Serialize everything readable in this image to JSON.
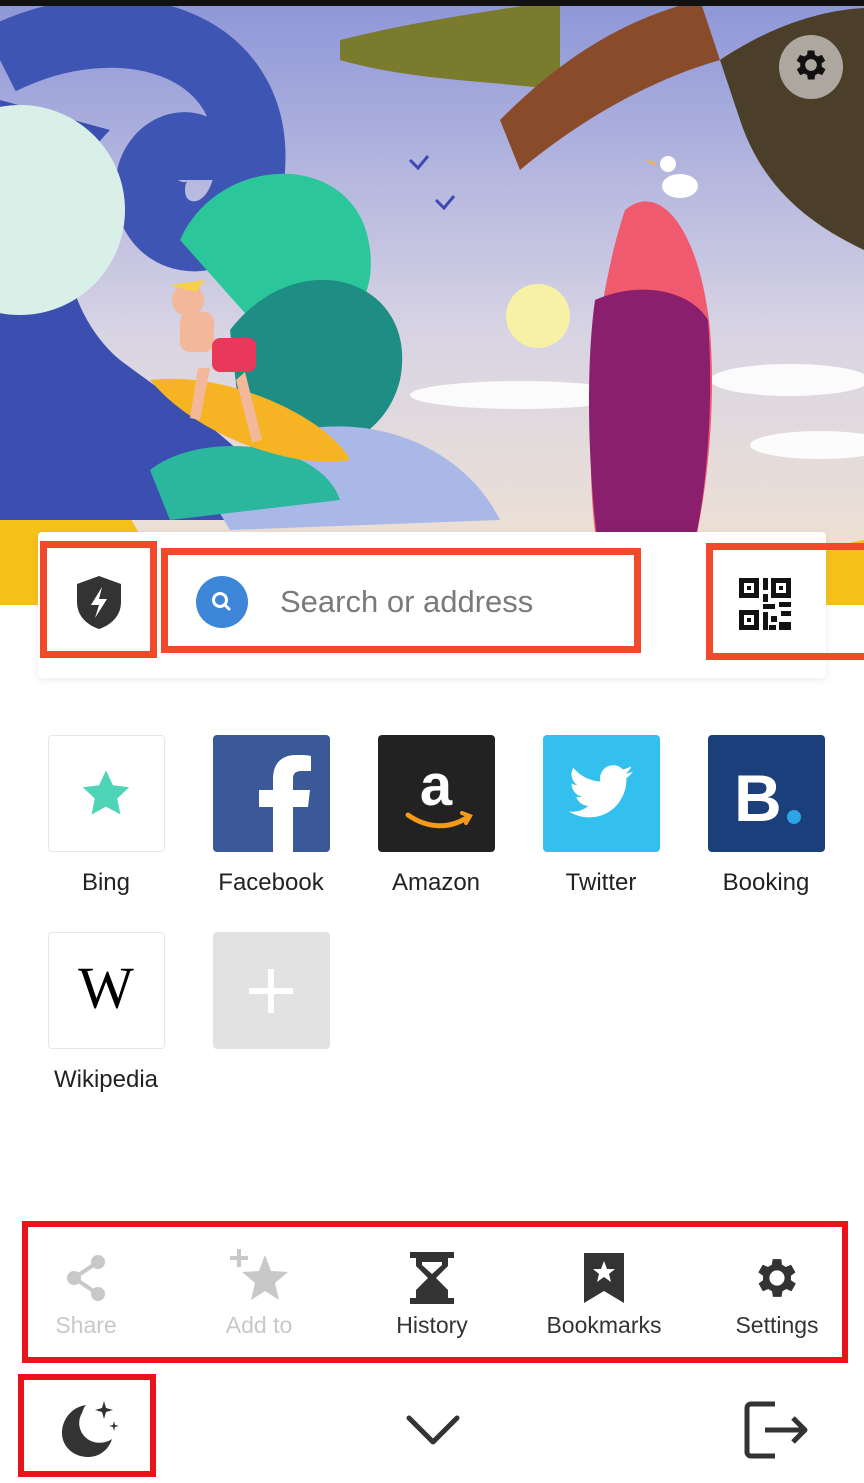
{
  "hero": {
    "settings_icon": "gear-icon"
  },
  "search": {
    "shield_icon": "shield-bolt-icon",
    "search_icon": "search-icon",
    "placeholder": "Search or address",
    "qr_icon": "qr-code-icon"
  },
  "speed_dial": [
    {
      "label": "Bing",
      "icon": "bing-star-icon",
      "color": "#4ed5b8"
    },
    {
      "label": "Facebook",
      "icon": "facebook-icon",
      "color": "#3b5998"
    },
    {
      "label": "Amazon",
      "icon": "amazon-icon",
      "color": "#222222"
    },
    {
      "label": "Twitter",
      "icon": "twitter-icon",
      "color": "#33c0ee"
    },
    {
      "label": "Booking",
      "icon": "booking-icon",
      "color": "#1b3f7a"
    },
    {
      "label": "Wikipedia",
      "icon": "wikipedia-icon",
      "color": "#000000"
    },
    {
      "label": "",
      "icon": "add-icon",
      "color": "#e2e2e2"
    }
  ],
  "menu": {
    "share": "Share",
    "add_to": "Add to",
    "history": "History",
    "bookmarks": "Bookmarks",
    "settings": "Settings"
  },
  "bottom_bar": {
    "night_mode_icon": "moon-stars-icon",
    "collapse_icon": "chevron-down-icon",
    "exit_icon": "exit-icon"
  },
  "colors": {
    "highlight_orange": "#f04a2a",
    "highlight_red": "#e8141a"
  }
}
